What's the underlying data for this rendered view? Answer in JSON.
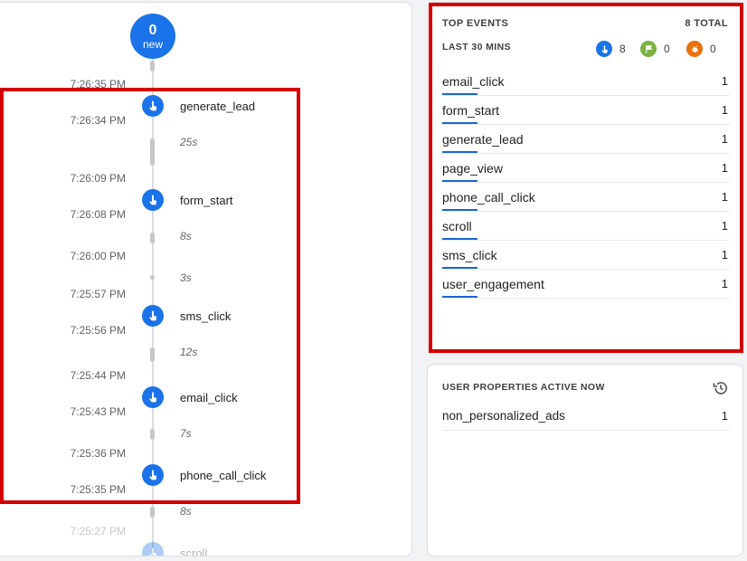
{
  "timeline": {
    "new_count": "0",
    "new_label": "new",
    "times": [
      "7:26:35 PM",
      "7:26:34 PM",
      "7:26:09 PM",
      "7:26:08 PM",
      "7:26:00 PM",
      "7:25:57 PM",
      "7:25:56 PM",
      "7:25:44 PM",
      "7:25:43 PM",
      "7:25:36 PM",
      "7:25:35 PM",
      "7:25:27 PM"
    ],
    "durations": [
      "25s",
      "8s",
      "3s",
      "12s",
      "7s",
      "8s"
    ],
    "events": [
      "generate_lead",
      "form_start",
      "sms_click",
      "email_click",
      "phone_call_click",
      "scroll"
    ]
  },
  "top_events": {
    "title": "TOP EVENTS",
    "total": "8 TOTAL",
    "period": "LAST 30 MINS",
    "stats": {
      "events": "8",
      "conversions": "0",
      "errors": "0"
    },
    "rows": [
      {
        "name": "email_click",
        "count": "1"
      },
      {
        "name": "form_start",
        "count": "1"
      },
      {
        "name": "generate_lead",
        "count": "1"
      },
      {
        "name": "page_view",
        "count": "1"
      },
      {
        "name": "phone_call_click",
        "count": "1"
      },
      {
        "name": "scroll",
        "count": "1"
      },
      {
        "name": "sms_click",
        "count": "1"
      },
      {
        "name": "user_engagement",
        "count": "1"
      }
    ]
  },
  "user_properties": {
    "title": "USER PROPERTIES ACTIVE NOW",
    "rows": [
      {
        "name": "non_personalized_ads",
        "count": "1"
      }
    ]
  },
  "colors": {
    "accent": "#1a73e8",
    "conversion": "#7cb342",
    "error": "#e8710a",
    "highlight": "#d40000"
  }
}
